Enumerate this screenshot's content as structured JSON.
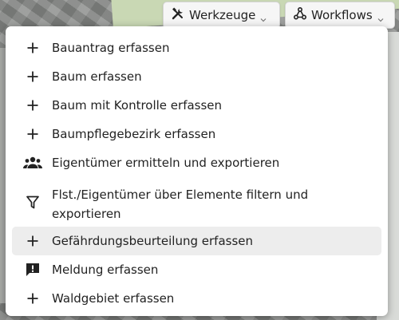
{
  "toolbar": {
    "werkzeuge_label": "Werkzeuge",
    "workflows_label": "Workflows"
  },
  "menu": {
    "items": [
      {
        "label": "Bauantrag erfassen",
        "icon": "plus-icon"
      },
      {
        "label": "Baum erfassen",
        "icon": "plus-icon"
      },
      {
        "label": "Baum mit Kontrolle erfassen",
        "icon": "plus-icon"
      },
      {
        "label": "Baumpflegebezirk erfassen",
        "icon": "plus-icon"
      },
      {
        "label": "Eigentümer ermitteln und exportieren",
        "icon": "people-icon"
      },
      {
        "label": "Flst./Eigentümer über Elemente filtern und exportieren",
        "icon": "filter-icon"
      },
      {
        "label": "Gefährdungsbeurteilung erfassen",
        "icon": "plus-icon",
        "highlighted": true
      },
      {
        "label": "Meldung erfassen",
        "icon": "report-icon"
      },
      {
        "label": "Waldgebiet erfassen",
        "icon": "plus-icon"
      }
    ]
  },
  "colors": {
    "menu_bg": "#ffffff",
    "highlight_bg": "#ededed",
    "text": "#222222"
  }
}
